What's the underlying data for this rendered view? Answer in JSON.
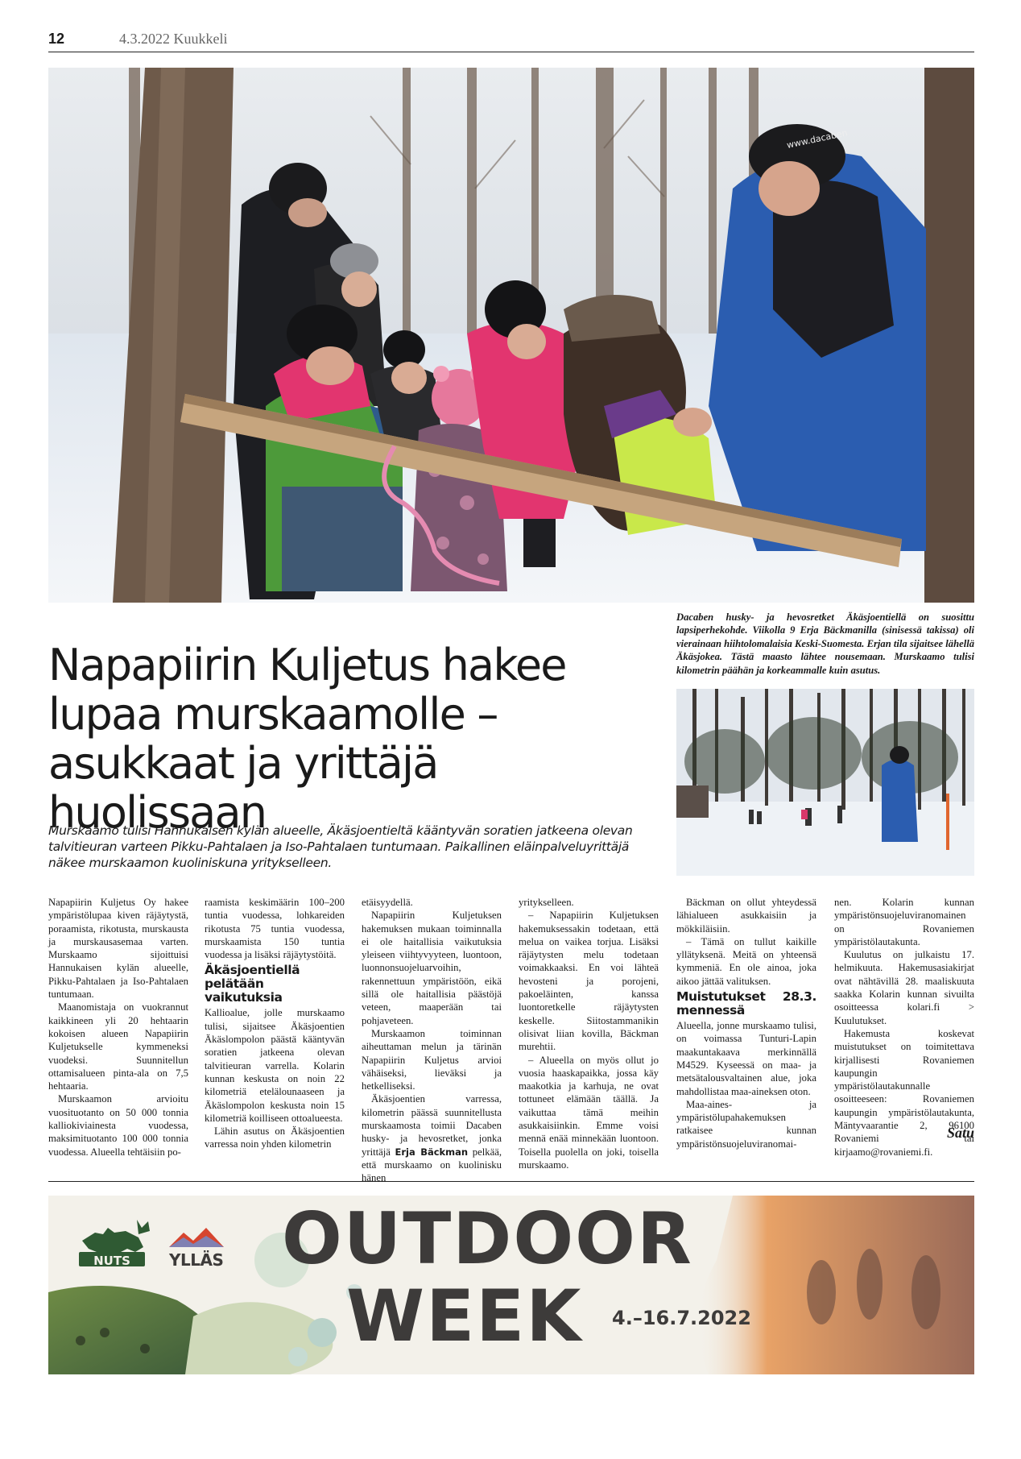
{
  "header": {
    "page_number": "12",
    "date_paper": "4.3.2022 Kuukkeli"
  },
  "photo": {
    "caption": "Dacaben husky- ja hevosretket Äkäsjoentiellä on suosittu lapsiperhekohde. Viikolla 9 Erja Bäckmanilla (sinisessä takissa) oli vierainaan hiihtolomalaisia Keski-Suomesta. Erjan tila sijaitsee lähellä Äkäsjokea. Tästä maasto lähtee nousemaan. Murskaamo tulisi kilometrin päähän ja korkeammalle kuin asutus.",
    "cap_text": "www.dacaben"
  },
  "article": {
    "headline": "Napapiirin Kuljetus hakee lupaa murskaamolle – asukkaat ja yrittäjä huolissaan",
    "lead": "Murskaamo tulisi Hannukaisen kylän alueelle, Äkäsjoentieltä kääntyvän soratien jatkeena olevan talvitieuran varteen Pikku-Pahtalaen ja Iso-Pahtalaen tuntumaan. Paikallinen eläinpalveluyrittäjä näkee murskaamon kuoliniskuna yritykselleen.",
    "col1": {
      "p1": "Napapiirin Kuljetus Oy hakee ympäristölupaa kiven räjäytystä, poraamista, rikotusta, murskausta ja murskausasemaa varten. Murskaamo sijoittuisi Hannukaisen kylän alueelle, Pikku-Pahtalaen ja Iso-Pahtalaen tuntumaan.",
      "p2": "Maanomistaja on vuokrannut kaikkineen yli 20 hehtaarin kokoisen alueen Napapiirin Kuljetukselle kymmeneksi vuodeksi. Suunnitellun ottamisalueen pinta-ala on 7,5 hehtaaria.",
      "p3": "Murskaamon arvioitu vuosituotanto on 50 000 tonnia kalliokiviainesta vuodessa, maksimituotanto 100 000 tonnia vuodessa. Alueella tehtäisiin po-"
    },
    "col2": {
      "p1": "raamista keskimäärin 100–200 tuntia vuodessa, lohkareiden rikotusta 75 tuntia vuodessa, murskaamista 150 tuntia vuodessa ja lisäksi räjäytystöitä.",
      "subhead": "Äkäsjoentiellä pelätään vaikutuksia",
      "p2": "Kallioalue, jolle murskaamo tulisi, sijaitsee Äkäsjoentien Äkäslompolon päästä kääntyvän soratien jatkeena olevan talvitieuran varrella. Kolarin kunnan keskusta on noin 22 kilometriä etelälounaaseen ja Äkäslompolon keskusta noin 15 kilometriä koilliseen ottoalueesta.",
      "p3": "Lähin asutus on Äkäsjoentien varressa noin yhden kilometrin"
    },
    "col3": {
      "p1": "etäisyydellä.",
      "p2": "Napapiirin Kuljetuksen hakemuksen mukaan toiminnalla ei ole haitallisia vaikutuksia yleiseen viihtyvyyteen, luontoon, luonnonsuojeluarvoihin, rakennettuun ympäristöön, eikä sillä ole haitallisia päästöjä veteen, maaperään tai pohjaveteen.",
      "p3": "Murskaamon toiminnan aiheuttaman melun ja tärinän Napapiirin Kuljetus arvioi vähäiseksi, lieväksi ja hetkelliseksi.",
      "p4a": "Äkäsjoentien varressa, kilometrin päässä suunnitellusta murskaamosta toimii Dacaben husky- ja hevosretket, jonka yrittäjä ",
      "p4name": "Erja Bäckman",
      "p4b": " pelkää, että murskaamo on kuolinisku hänen"
    },
    "col4": {
      "p1": "yritykselleen.",
      "p2": "– Napapiirin Kuljetuksen hakemuksessakin todetaan, että melua on vaikea torjua. Lisäksi räjäytysten melu todetaan voimakkaaksi. En voi lähteä hevosteni ja porojeni, pakoeläinten, kanssa luontoretkelle räjäytysten keskelle. Siitostammanikin olisivat liian kovilla, Bäckman murehtii.",
      "p3": "– Alueella on myös ollut jo vuosia haaskapaikka, jossa käy maakotkia ja karhuja, ne ovat tottuneet elämään täällä. Ja vaikuttaa tämä meihin asukkaisiinkin. Emme voisi mennä enää minnekään luontoon. Toisella puolella on joki, toisella murskaamo."
    },
    "col5": {
      "p1": "Bäckman on ollut yhteydessä lähialueen asukkaisiin ja mökkiläisiin.",
      "p2": "– Tämä on tullut kaikille yllätyksenä. Meitä on yhteensä kymmeniä. En ole ainoa, joka aikoo jättää valituksen.",
      "subhead": "Muistutukset 28.3. mennessä",
      "p3": "Alueella, jonne murskaamo tulisi, on voimassa Tunturi-Lapin maakuntakaava merkinnällä M4529. Kyseessä on maa- ja metsätalousvaltainen alue, joka mahdollistaa maa-aineksen oton.",
      "p4": "Maa-aines- ja ympäristölupahakemuksen ratkaisee kunnan ympäristönsuojeluviranomai-"
    },
    "col6": {
      "p1": "nen. Kolarin kunnan ympäristönsuojeluviranomainen on Rovaniemen ympäristölautakunta.",
      "p2": "Kuulutus on julkaistu 17. helmikuuta. Hakemusasiakirjat ovat nähtävillä 28. maaliskuuta saakka Kolarin kunnan sivuilta osoitteessa kolari.fi > Kuulutukset.",
      "p3": "Hakemusta koskevat muistutukset on toimitettava kirjallisesti Rovaniemen kaupungin ympäristölautakunnalle osoitteeseen: Rovaniemen kaupungin ympäristölautakunta, Mäntyvaarantie 2, 96100 Rovaniemi tai kirjaamo@rovaniemi.fi."
    },
    "signature": "Satu"
  },
  "ad": {
    "logo1": "NUTS",
    "logo2": "YLLÄS",
    "title1": "OUTDOOR",
    "title2": "WEEK",
    "dates": "4.–16.7.2022"
  },
  "colors": {
    "rule": "#222222",
    "ad_text": "#3d3b3a",
    "nuts_green": "#2f5a33",
    "jacket_pink": "#e2356f",
    "jacket_blue": "#2b5db0"
  }
}
